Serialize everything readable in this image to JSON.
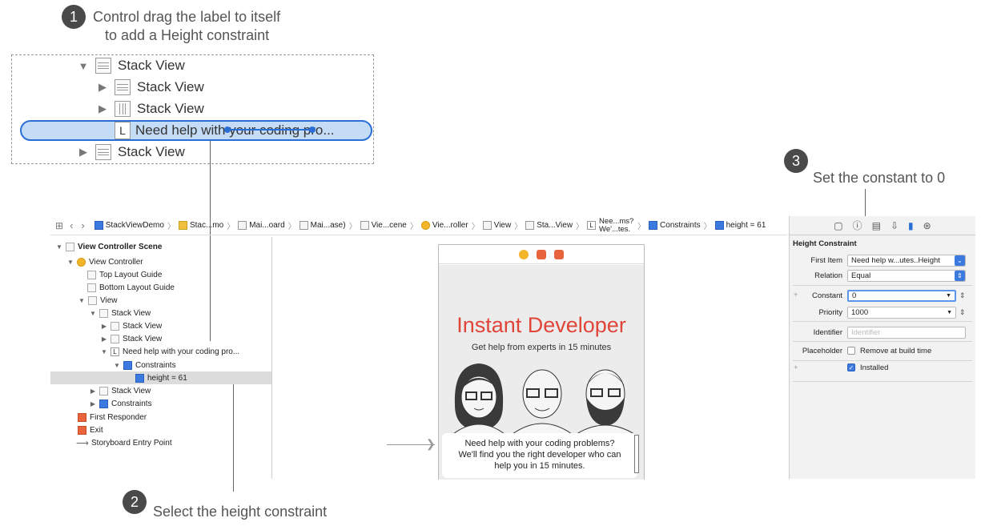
{
  "callouts": {
    "step1": {
      "number": "1",
      "line1": "Control drag the label to itself",
      "line2": "to add a Height constraint"
    },
    "step2": {
      "number": "2",
      "text": "Select the height constraint"
    },
    "step3": {
      "number": "3",
      "text": "Set the constant to 0"
    }
  },
  "zoom_outline": {
    "rows": [
      {
        "label": "Stack View"
      },
      {
        "label": "Stack View"
      },
      {
        "label": "Stack View"
      },
      {
        "label": "Need help with your coding pro..."
      },
      {
        "label": "Stack View"
      }
    ],
    "label_glyph": "L"
  },
  "jumpbar": {
    "items": [
      "StackViewDemo",
      "Stac...mo",
      "Mai...oard",
      "Mai...ase)",
      "Vie...cene",
      "Vie...roller",
      "View",
      "Sta...View",
      "Nee...ms? We'...tes.",
      "Constraints",
      "height = 61"
    ],
    "label_glyph": "L"
  },
  "outline": {
    "rows": [
      "View Controller Scene",
      "View Controller",
      "Top Layout Guide",
      "Bottom Layout Guide",
      "View",
      "Stack View",
      "Stack View",
      "Stack View",
      "Need help with your coding pro...",
      "Constraints",
      "height = 61",
      "Stack View",
      "Constraints",
      "First Responder",
      "Exit",
      "Storyboard Entry Point"
    ],
    "label_glyph": "L"
  },
  "phone": {
    "title": "Instant Developer",
    "subtitle": "Get help from experts in 15 minutes",
    "message_line1": "Need help with your coding problems?",
    "message_line2": "We'll find you the right developer who can",
    "message_line3": "help you in 15 minutes."
  },
  "inspector": {
    "heading": "Height Constraint",
    "first_item_label": "First Item",
    "first_item_value": "Need help w...utes..Height",
    "relation_label": "Relation",
    "relation_value": "Equal",
    "constant_label": "Constant",
    "constant_value": "0",
    "priority_label": "Priority",
    "priority_value": "1000",
    "identifier_label": "Identifier",
    "identifier_placeholder": "Identifier",
    "placeholder_label": "Placeholder",
    "placeholder_option": "Remove at build time",
    "installed_label": "Installed",
    "add_glyph": "+"
  },
  "colors": {
    "accent": "#2a6fd6",
    "title_red": "#e0453a"
  }
}
